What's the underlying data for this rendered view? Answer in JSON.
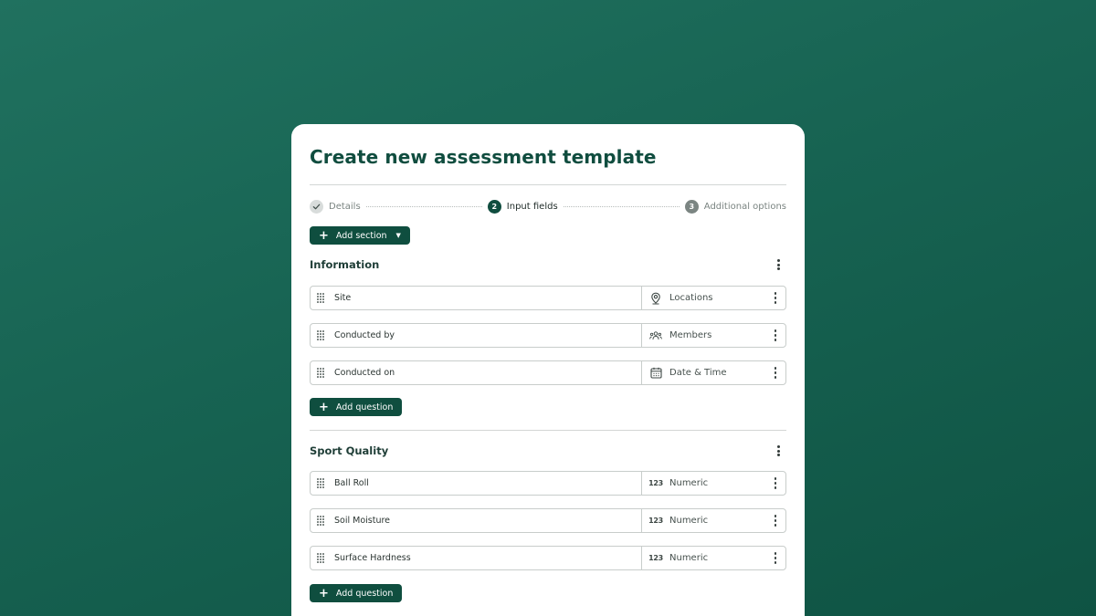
{
  "dialog": {
    "title": "Create new assessment template"
  },
  "stepper": {
    "steps": [
      {
        "number": "1",
        "label": "Details",
        "state": "done"
      },
      {
        "number": "2",
        "label": "Input fields",
        "state": "active"
      },
      {
        "number": "3",
        "label": "Additional options",
        "state": "todo"
      }
    ]
  },
  "add_section_button": {
    "label": "Add section"
  },
  "sections": [
    {
      "title": "Information",
      "fields": [
        {
          "label": "Site",
          "type": "Locations",
          "icon": "location-pin-icon"
        },
        {
          "label": "Conducted by",
          "type": "Members",
          "icon": "members-icon"
        },
        {
          "label": "Conducted on",
          "type": "Date & Time",
          "icon": "calendar-icon"
        }
      ],
      "add_question_label": "Add question"
    },
    {
      "title": "Sport Quality",
      "fields": [
        {
          "label": "Ball Roll",
          "type": "Numeric",
          "icon": "numeric-icon",
          "icon_text": "123"
        },
        {
          "label": "Soil Moisture",
          "type": "Numeric",
          "icon": "numeric-icon",
          "icon_text": "123"
        },
        {
          "label": "Surface Hardness",
          "type": "Numeric",
          "icon": "numeric-icon",
          "icon_text": "123"
        }
      ],
      "add_question_label": "Add question"
    }
  ],
  "colors": {
    "background": "#176352",
    "brand": "#0f4e3f",
    "card": "#ffffff"
  }
}
